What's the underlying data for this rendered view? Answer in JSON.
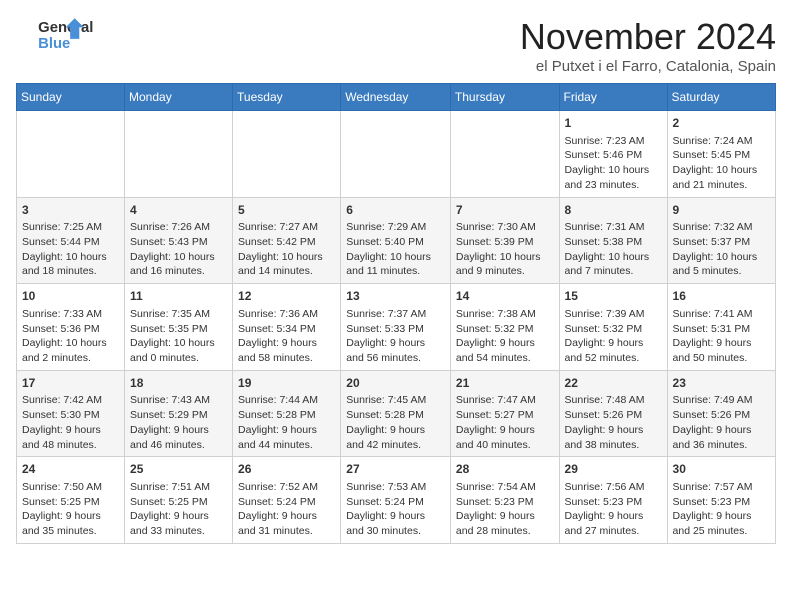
{
  "header": {
    "logo_line1": "General",
    "logo_line2": "Blue",
    "month_title": "November 2024",
    "location": "el Putxet i el Farro, Catalonia, Spain"
  },
  "days_of_week": [
    "Sunday",
    "Monday",
    "Tuesday",
    "Wednesday",
    "Thursday",
    "Friday",
    "Saturday"
  ],
  "weeks": [
    [
      {
        "day": "",
        "content": ""
      },
      {
        "day": "",
        "content": ""
      },
      {
        "day": "",
        "content": ""
      },
      {
        "day": "",
        "content": ""
      },
      {
        "day": "",
        "content": ""
      },
      {
        "day": "1",
        "content": "Sunrise: 7:23 AM\nSunset: 5:46 PM\nDaylight: 10 hours and 23 minutes."
      },
      {
        "day": "2",
        "content": "Sunrise: 7:24 AM\nSunset: 5:45 PM\nDaylight: 10 hours and 21 minutes."
      }
    ],
    [
      {
        "day": "3",
        "content": "Sunrise: 7:25 AM\nSunset: 5:44 PM\nDaylight: 10 hours and 18 minutes."
      },
      {
        "day": "4",
        "content": "Sunrise: 7:26 AM\nSunset: 5:43 PM\nDaylight: 10 hours and 16 minutes."
      },
      {
        "day": "5",
        "content": "Sunrise: 7:27 AM\nSunset: 5:42 PM\nDaylight: 10 hours and 14 minutes."
      },
      {
        "day": "6",
        "content": "Sunrise: 7:29 AM\nSunset: 5:40 PM\nDaylight: 10 hours and 11 minutes."
      },
      {
        "day": "7",
        "content": "Sunrise: 7:30 AM\nSunset: 5:39 PM\nDaylight: 10 hours and 9 minutes."
      },
      {
        "day": "8",
        "content": "Sunrise: 7:31 AM\nSunset: 5:38 PM\nDaylight: 10 hours and 7 minutes."
      },
      {
        "day": "9",
        "content": "Sunrise: 7:32 AM\nSunset: 5:37 PM\nDaylight: 10 hours and 5 minutes."
      }
    ],
    [
      {
        "day": "10",
        "content": "Sunrise: 7:33 AM\nSunset: 5:36 PM\nDaylight: 10 hours and 2 minutes."
      },
      {
        "day": "11",
        "content": "Sunrise: 7:35 AM\nSunset: 5:35 PM\nDaylight: 10 hours and 0 minutes."
      },
      {
        "day": "12",
        "content": "Sunrise: 7:36 AM\nSunset: 5:34 PM\nDaylight: 9 hours and 58 minutes."
      },
      {
        "day": "13",
        "content": "Sunrise: 7:37 AM\nSunset: 5:33 PM\nDaylight: 9 hours and 56 minutes."
      },
      {
        "day": "14",
        "content": "Sunrise: 7:38 AM\nSunset: 5:32 PM\nDaylight: 9 hours and 54 minutes."
      },
      {
        "day": "15",
        "content": "Sunrise: 7:39 AM\nSunset: 5:32 PM\nDaylight: 9 hours and 52 minutes."
      },
      {
        "day": "16",
        "content": "Sunrise: 7:41 AM\nSunset: 5:31 PM\nDaylight: 9 hours and 50 minutes."
      }
    ],
    [
      {
        "day": "17",
        "content": "Sunrise: 7:42 AM\nSunset: 5:30 PM\nDaylight: 9 hours and 48 minutes."
      },
      {
        "day": "18",
        "content": "Sunrise: 7:43 AM\nSunset: 5:29 PM\nDaylight: 9 hours and 46 minutes."
      },
      {
        "day": "19",
        "content": "Sunrise: 7:44 AM\nSunset: 5:28 PM\nDaylight: 9 hours and 44 minutes."
      },
      {
        "day": "20",
        "content": "Sunrise: 7:45 AM\nSunset: 5:28 PM\nDaylight: 9 hours and 42 minutes."
      },
      {
        "day": "21",
        "content": "Sunrise: 7:47 AM\nSunset: 5:27 PM\nDaylight: 9 hours and 40 minutes."
      },
      {
        "day": "22",
        "content": "Sunrise: 7:48 AM\nSunset: 5:26 PM\nDaylight: 9 hours and 38 minutes."
      },
      {
        "day": "23",
        "content": "Sunrise: 7:49 AM\nSunset: 5:26 PM\nDaylight: 9 hours and 36 minutes."
      }
    ],
    [
      {
        "day": "24",
        "content": "Sunrise: 7:50 AM\nSunset: 5:25 PM\nDaylight: 9 hours and 35 minutes."
      },
      {
        "day": "25",
        "content": "Sunrise: 7:51 AM\nSunset: 5:25 PM\nDaylight: 9 hours and 33 minutes."
      },
      {
        "day": "26",
        "content": "Sunrise: 7:52 AM\nSunset: 5:24 PM\nDaylight: 9 hours and 31 minutes."
      },
      {
        "day": "27",
        "content": "Sunrise: 7:53 AM\nSunset: 5:24 PM\nDaylight: 9 hours and 30 minutes."
      },
      {
        "day": "28",
        "content": "Sunrise: 7:54 AM\nSunset: 5:23 PM\nDaylight: 9 hours and 28 minutes."
      },
      {
        "day": "29",
        "content": "Sunrise: 7:56 AM\nSunset: 5:23 PM\nDaylight: 9 hours and 27 minutes."
      },
      {
        "day": "30",
        "content": "Sunrise: 7:57 AM\nSunset: 5:23 PM\nDaylight: 9 hours and 25 minutes."
      }
    ]
  ]
}
